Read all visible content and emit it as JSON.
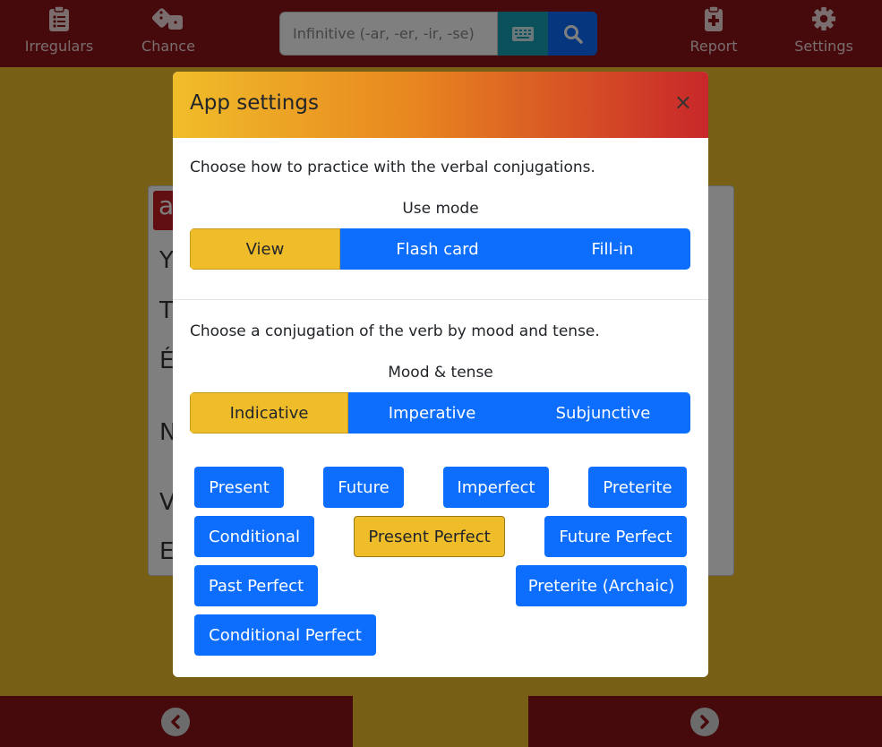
{
  "nav": {
    "irregulars": "Irregulars",
    "chance": "Chance",
    "report": "Report",
    "settings": "Settings"
  },
  "search": {
    "placeholder": "Infinitive (-ar, -er, -ir, -se)"
  },
  "background": {
    "chip_letter": "a",
    "rows": [
      "Y",
      "T",
      "É",
      "N",
      "V",
      "E"
    ]
  },
  "modal": {
    "title": "App settings",
    "close": "×",
    "practice_desc": "Choose how to practice with the verbal conjugations.",
    "use_mode_label": "Use mode",
    "use_modes": [
      "View",
      "Flash card",
      "Fill-in"
    ],
    "use_mode_active": "View",
    "conjugation_desc": "Choose a conjugation of the verb by mood and tense.",
    "mood_label": "Mood & tense",
    "moods": [
      "Indicative",
      "Imperative",
      "Subjunctive"
    ],
    "mood_active": "Indicative",
    "tenses": [
      "Present",
      "Future",
      "Imperfect",
      "Preterite",
      "Conditional",
      "Present Perfect",
      "Future Perfect",
      "Past Perfect",
      "Preterite (Archaic)",
      "Conditional Perfect"
    ],
    "tense_active": "Present Perfect"
  },
  "colors": {
    "brand_red": "#8c1219",
    "accent_yellow": "#f0bd2a",
    "primary_blue": "#0d6efd",
    "info_teal": "#16a2b8"
  }
}
